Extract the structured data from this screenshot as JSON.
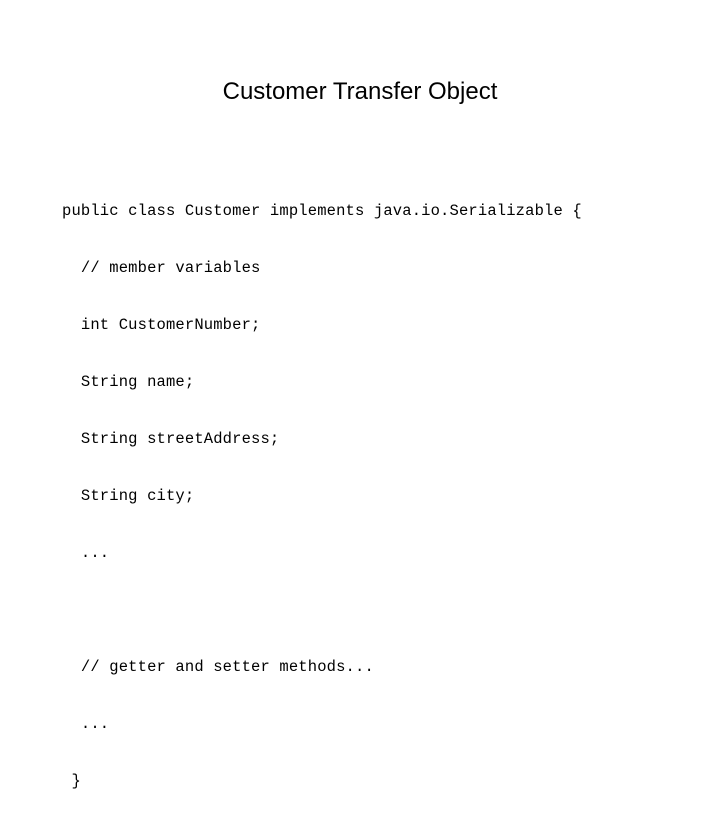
{
  "slide": {
    "title": "Customer Transfer Object",
    "background_color": "#ffffff",
    "text_color": "#000000"
  },
  "code": {
    "language": "java",
    "lines": [
      "public class Customer implements java.io.Serializable {",
      "  // member variables",
      "  int CustomerNumber;",
      "  String name;",
      "  String streetAddress;",
      "  String city;",
      "  ...",
      "",
      "  // getter and setter methods...",
      "  ...",
      " }"
    ]
  }
}
